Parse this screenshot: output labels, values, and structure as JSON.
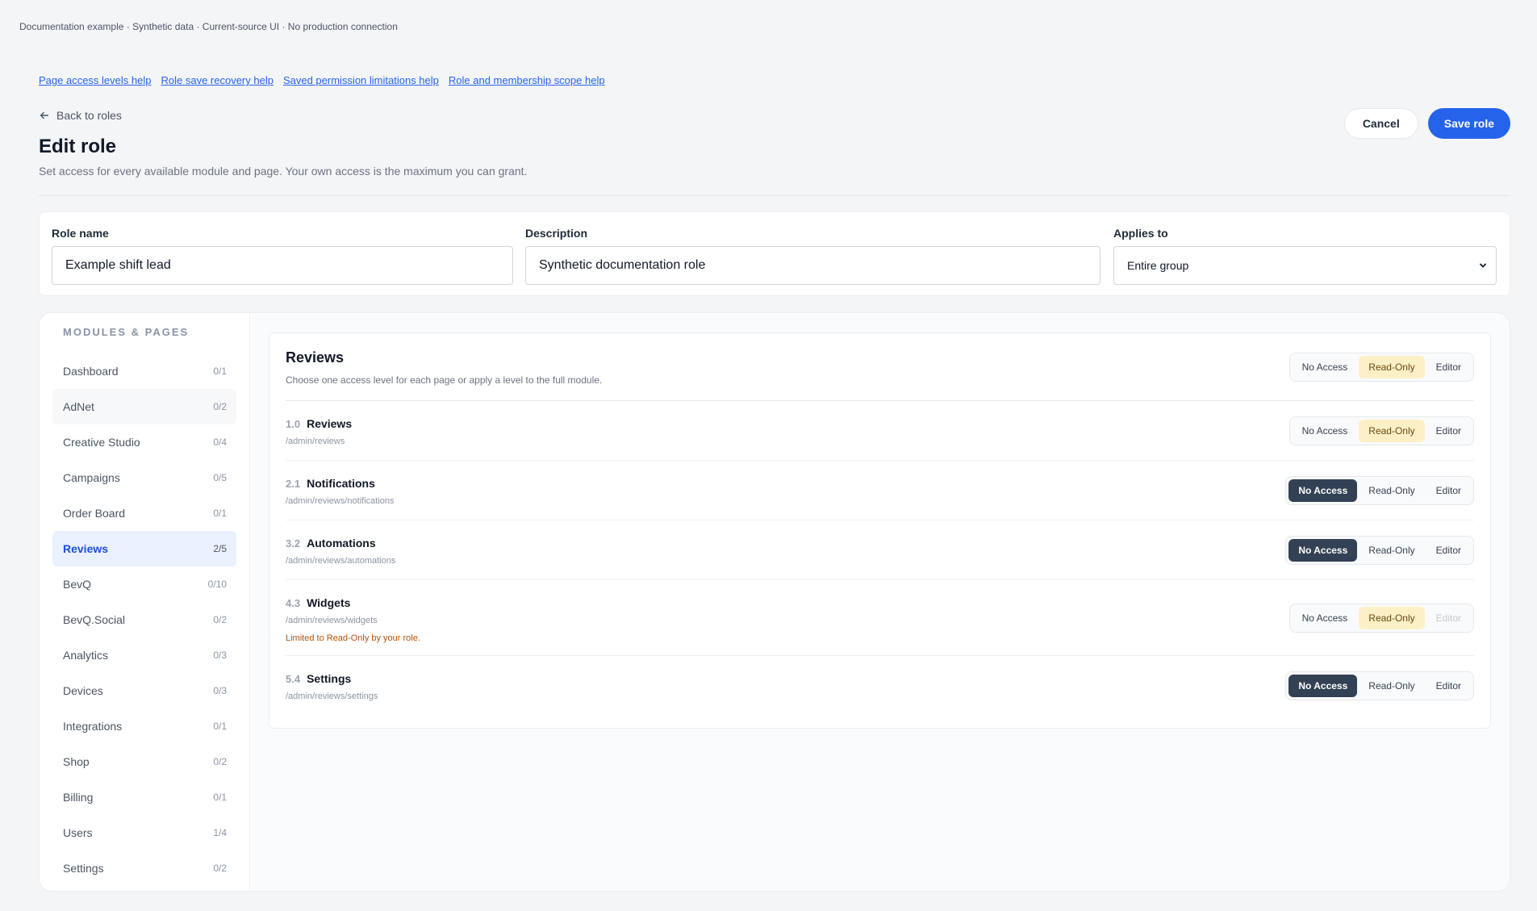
{
  "top_note": "Documentation example · Synthetic data · Current-source UI · No production connection",
  "help_links": [
    "Page access levels help",
    "Role save recovery help",
    "Saved permission limitations help",
    "Role and membership scope help"
  ],
  "header": {
    "back_label": "Back to roles",
    "title": "Edit role",
    "subtitle": "Set access for every available module and page. Your own access is the maximum you can grant.",
    "cancel_label": "Cancel",
    "save_label": "Save role"
  },
  "form": {
    "role_name_label": "Role name",
    "role_name_value": "Example shift lead",
    "description_label": "Description",
    "description_value": "Synthetic documentation role",
    "applies_to_label": "Applies to",
    "applies_to_value": "Entire group"
  },
  "sidebar": {
    "title": "MODULES & PAGES",
    "items": [
      {
        "label": "Dashboard",
        "count": "0/1"
      },
      {
        "label": "AdNet",
        "count": "0/2"
      },
      {
        "label": "Creative Studio",
        "count": "0/4"
      },
      {
        "label": "Campaigns",
        "count": "0/5"
      },
      {
        "label": "Order Board",
        "count": "0/1"
      },
      {
        "label": "Reviews",
        "count": "2/5"
      },
      {
        "label": "BevQ",
        "count": "0/10"
      },
      {
        "label": "BevQ.Social",
        "count": "0/2"
      },
      {
        "label": "Analytics",
        "count": "0/3"
      },
      {
        "label": "Devices",
        "count": "0/3"
      },
      {
        "label": "Integrations",
        "count": "0/1"
      },
      {
        "label": "Shop",
        "count": "0/2"
      },
      {
        "label": "Billing",
        "count": "0/1"
      },
      {
        "label": "Users",
        "count": "1/4"
      },
      {
        "label": "Settings",
        "count": "0/2"
      }
    ]
  },
  "access_levels": [
    "No Access",
    "Read-Only",
    "Editor"
  ],
  "module": {
    "title": "Reviews",
    "description": "Choose one access level for each page or apply a level to the full module.",
    "selected": "Read-Only",
    "pages": [
      {
        "num": "1.0",
        "name": "Reviews",
        "path": "/admin/reviews",
        "selected": "Read-Only",
        "warning": ""
      },
      {
        "num": "2.1",
        "name": "Notifications",
        "path": "/admin/reviews/notifications",
        "selected": "No Access",
        "warning": ""
      },
      {
        "num": "3.2",
        "name": "Automations",
        "path": "/admin/reviews/automations",
        "selected": "No Access",
        "warning": ""
      },
      {
        "num": "4.3",
        "name": "Widgets",
        "path": "/admin/reviews/widgets",
        "selected": "Read-Only",
        "warning": "Limited to Read-Only by your role."
      },
      {
        "num": "5.4",
        "name": "Settings",
        "path": "/admin/reviews/settings",
        "selected": "No Access",
        "warning": ""
      }
    ]
  }
}
